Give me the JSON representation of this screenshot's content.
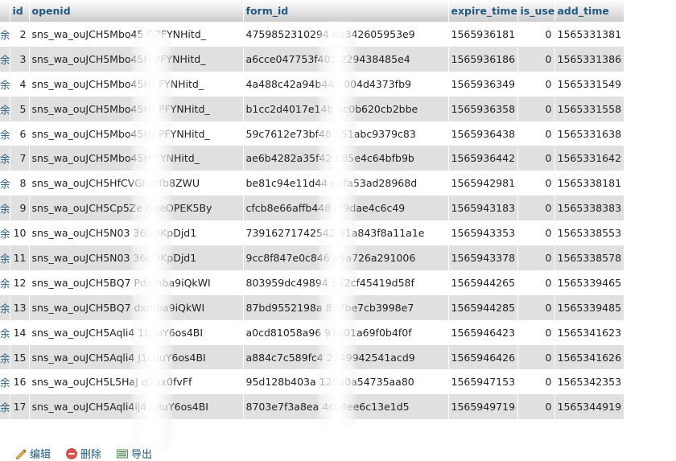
{
  "columns": [
    "",
    "id",
    "openid",
    "form_id",
    "expire_time",
    "is_use",
    "add_time"
  ],
  "row_action_glyph": "余",
  "rows": [
    {
      "id": "2",
      "openid": "sns_wa_ouJCH5Mbo45    QPFYNHitd_",
      "form_id": "4759852310294       eb342605953e9",
      "expire_time": "1565936181",
      "is_use": "0",
      "add_time": "1565331381"
    },
    {
      "id": "3",
      "openid": "sns_wa_ouJCH5Mbo45H      PFYNHitd_",
      "form_id": "a6cce047753f401      229438485e4",
      "expire_time": "1565936186",
      "is_use": "0",
      "add_time": "1565331386"
    },
    {
      "id": "4",
      "openid": "sns_wa_ouJCH5Mbo45Hr      FYNHitd_",
      "form_id": "4a488c42a94b447      004d4373fb9",
      "expire_time": "1565936349",
      "is_use": "0",
      "add_time": "1565331549"
    },
    {
      "id": "5",
      "openid": "sns_wa_ouJCH5Mbo45Hr      PFYNHitd_",
      "form_id": "b1cc2d4017e14b      bc0b620cb2bbe",
      "expire_time": "1565936358",
      "is_use": "0",
      "add_time": "1565331558"
    },
    {
      "id": "6",
      "openid": "sns_wa_ouJCH5Mbo45Hr      PFYNHitd_",
      "form_id": "59c7612e73bf48      551abc9379c83",
      "expire_time": "1565936438",
      "is_use": "0",
      "add_time": "1565331638"
    },
    {
      "id": "7",
      "openid": "sns_wa_ouJCH5Mbo45H      FYNHitd_",
      "form_id": "ae6b4282a35f42      685e4c64bfb9b",
      "expire_time": "1565936442",
      "is_use": "0",
      "add_time": "1565331642"
    },
    {
      "id": "8",
      "openid": "sns_wa_ouJCH5HfCVGI      nrfb8ZWU",
      "form_id": "be81c94e11d44      e5fa53ad28968d",
      "expire_time": "1565942981",
      "is_use": "0",
      "add_time": "1565338181"
    },
    {
      "id": "9",
      "openid": "sns_wa_ouJCH5Cp5Ze      HqeOPEK5By",
      "form_id": "cfcb8e66affb448      cf9dae4c6c49",
      "expire_time": "1565943183",
      "is_use": "0",
      "add_time": "1565338383"
    },
    {
      "id": "10",
      "openid": "sns_wa_ouJCH5N03      36uOKpDjd1",
      "form_id": "73916271742542      01a843f8a11a1e",
      "expire_time": "1565943353",
      "is_use": "0",
      "add_time": "1565338553"
    },
    {
      "id": "11",
      "openid": "sns_wa_ouJCH5N03      36uOKpDjd1",
      "form_id": "9cc8f847e0c846      a5a726a291006",
      "expire_time": "1565943378",
      "is_use": "0",
      "add_time": "1565338578"
    },
    {
      "id": "12",
      "openid": "sns_wa_ouJCH5BQ7      Pdxmba9iQkWI",
      "form_id": "803959dc49894      542cf45419d58f",
      "expire_time": "1565944265",
      "is_use": "0",
      "add_time": "1565339465"
    },
    {
      "id": "13",
      "openid": "sns_wa_ouJCH5BQ7      dxmba9iQkWI",
      "form_id": "87bd9552198a      877be7cb3998e7",
      "expire_time": "1565944285",
      "is_use": "0",
      "add_time": "1565339485"
    },
    {
      "id": "14",
      "openid": "sns_wa_ouJCH5Aqli4      1LduY6os4BI",
      "form_id": "a0cd81058a96      97601a69f0b4f0f",
      "expire_time": "1565946423",
      "is_use": "0",
      "add_time": "1565341623"
    },
    {
      "id": "15",
      "openid": "sns_wa_ouJCH5Aqli4      J1LduY6os4BI",
      "form_id": "a884c7c589fc4      2249942541acd9",
      "expire_time": "1565946426",
      "is_use": "0",
      "add_time": "1565341626"
    },
    {
      "id": "16",
      "openid": "sns_wa_ouJCH5L5HaJ      q2ux0fvFf",
      "form_id": "95d128b403a      125a0a54735aa80",
      "expire_time": "1565947153",
      "is_use": "0",
      "add_time": "1565342353"
    },
    {
      "id": "17",
      "openid": "sns_wa_ouJCH5Aqli4ij4      LduY6os4BI",
      "form_id": "8703e7f3a8ea      4cb8ee6c13e1d5",
      "expire_time": "1565949719",
      "is_use": "0",
      "add_time": "1565344919"
    }
  ],
  "actions": {
    "edit": "编辑",
    "delete": "删除",
    "export": "导出"
  },
  "icons": {
    "edit": "pencil-icon",
    "delete": "delete-icon",
    "export": "export-icon"
  },
  "colors": {
    "header_text": "#235a81",
    "row_even": "#e0e0e0",
    "row_odd": "#ffffff",
    "delete_icon": "#d9534f"
  }
}
